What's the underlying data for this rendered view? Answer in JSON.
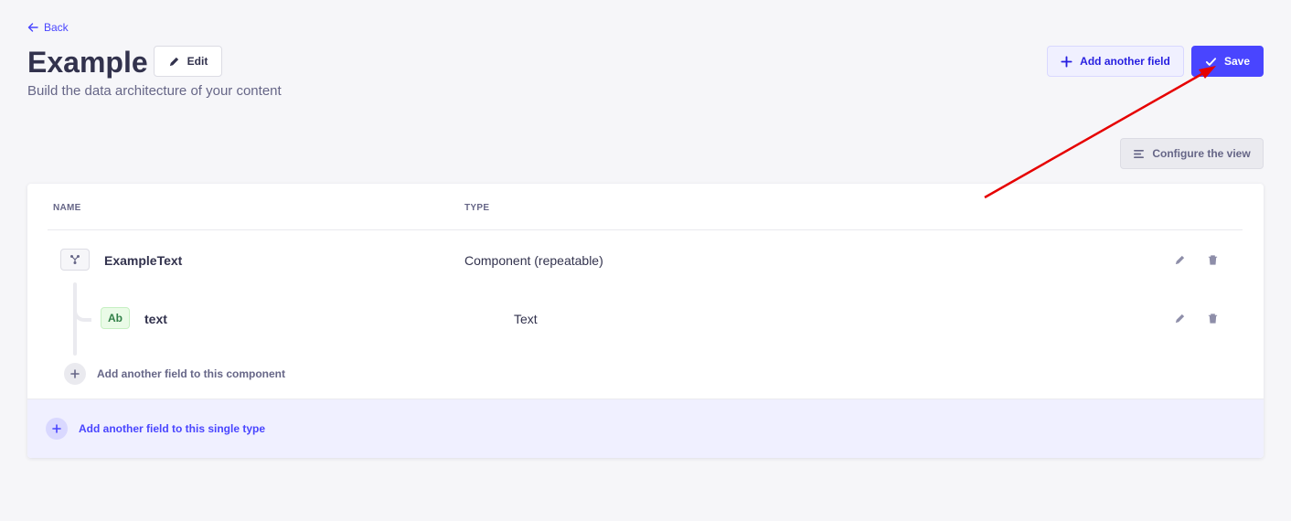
{
  "header": {
    "back_label": "Back",
    "title": "Example",
    "edit_label": "Edit",
    "subtitle": "Build the data architecture of your content",
    "add_field_label": "Add another field",
    "save_label": "Save",
    "configure_label": "Configure the view"
  },
  "table": {
    "columns": [
      "NAME",
      "TYPE"
    ],
    "rows": [
      {
        "name": "ExampleText",
        "type": "Component (repeatable)",
        "icon": "component-icon"
      },
      {
        "name": "text",
        "type": "Text",
        "badge": "Ab",
        "nested": true
      }
    ],
    "add_component_field_label": "Add another field to this component",
    "add_single_type_field_label": "Add another field to this single type"
  },
  "colors": {
    "primary": "#4945ff",
    "annotation_arrow": "#e60000"
  }
}
